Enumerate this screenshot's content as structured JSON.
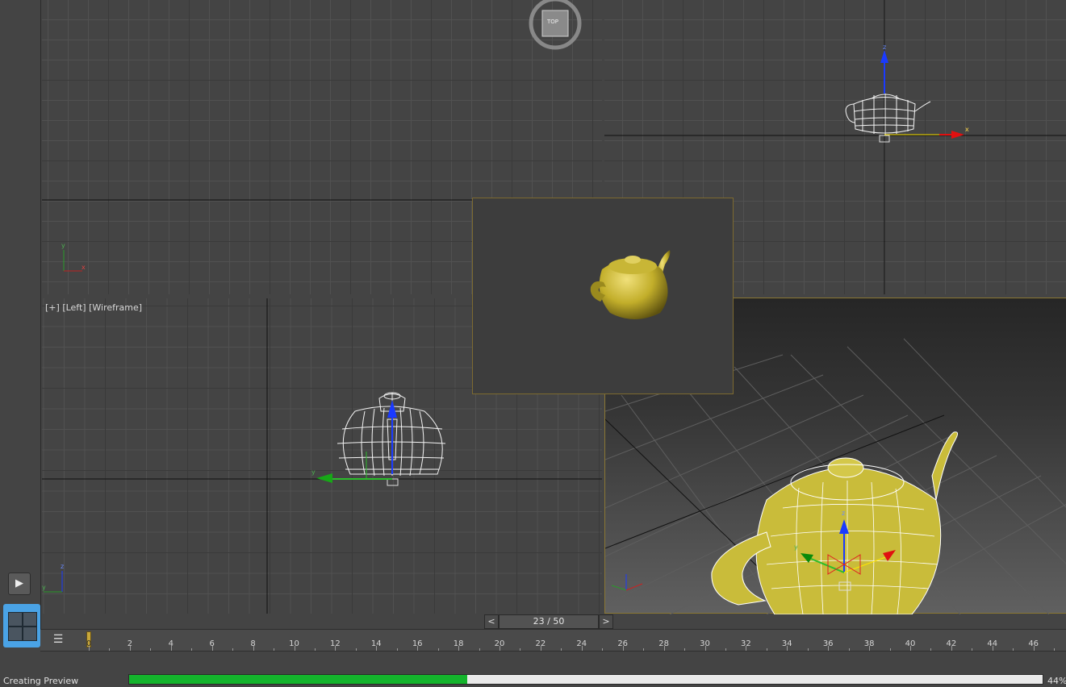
{
  "viewports": {
    "top": {
      "viewcube_label": "TOP"
    },
    "left": {
      "label_plus": "[+]",
      "label_view": "[Left]",
      "label_shading": "[Wireframe]"
    }
  },
  "axes": {
    "x": "x",
    "y": "y",
    "z": "z"
  },
  "frame_slider": {
    "prev": "<",
    "value": "23 / 50",
    "next": ">"
  },
  "timeline": {
    "marker": "0",
    "labels": [
      "2",
      "4",
      "6",
      "8",
      "10",
      "12",
      "14",
      "16",
      "18",
      "20",
      "22",
      "24",
      "26",
      "28",
      "30",
      "32",
      "34",
      "36",
      "38",
      "40",
      "42",
      "44",
      "46"
    ]
  },
  "status": {
    "text": "Creating Preview",
    "progress": 0.37,
    "percent": "44%"
  },
  "controls": {
    "play": "▶"
  },
  "colors": {
    "progress": "#14b42c",
    "teapot": "#c9bc3a",
    "selection_border": "#8a7734",
    "layout_button": "#4aa3e6"
  }
}
